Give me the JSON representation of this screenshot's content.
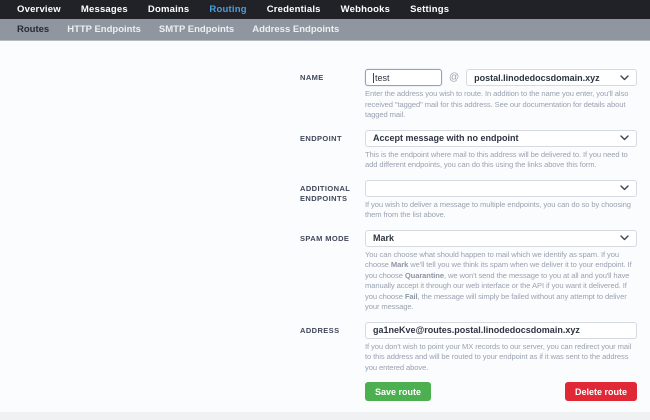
{
  "colors": {
    "accent": "#4f9ddb",
    "green": "#4caf50",
    "red": "#e02836",
    "topnav_bg": "#212227",
    "subnav_bg": "#8f969f"
  },
  "nav": {
    "items": [
      {
        "label": "Overview",
        "active": false
      },
      {
        "label": "Messages",
        "active": false
      },
      {
        "label": "Domains",
        "active": false
      },
      {
        "label": "Routing",
        "active": true
      },
      {
        "label": "Credentials",
        "active": false
      },
      {
        "label": "Webhooks",
        "active": false
      },
      {
        "label": "Settings",
        "active": false
      }
    ]
  },
  "subnav": {
    "items": [
      {
        "label": "Routes",
        "active": true
      },
      {
        "label": "HTTP Endpoints",
        "active": false
      },
      {
        "label": "SMTP Endpoints",
        "active": false
      },
      {
        "label": "Address Endpoints",
        "active": false
      }
    ]
  },
  "form": {
    "name": {
      "label": "NAME",
      "value": "test",
      "at": "@",
      "domain": "postal.linodedocsdomain.xyz",
      "help": "Enter the address you wish to route. In addition to the name you enter, you'll also received \"tagged\" mail for this address. See our documentation for details about tagged mail."
    },
    "endpoint": {
      "label": "ENDPOINT",
      "value": "Accept message with no endpoint",
      "help": "This is the endpoint where mail to this address will be delivered to. If you need to add different endpoints, you can do this using the links above this form."
    },
    "additional_endpoints": {
      "label": "ADDITIONAL ENDPOINTS",
      "value": "",
      "help": "If you wish to deliver a message to multiple endpoints, you can do so by choosing them from the list above."
    },
    "spam_mode": {
      "label": "SPAM MODE",
      "value": "Mark",
      "help_parts": [
        {
          "t": "You can choose what should happen to mail which we identify as spam. If you choose "
        },
        {
          "t": "Mark",
          "b": true
        },
        {
          "t": " we'll tell you we think its spam when we deliver it to your endpoint. If you choose "
        },
        {
          "t": "Quarantine",
          "b": true
        },
        {
          "t": ", we won't send the message to you at all and you'll have manually accept it through our web interface or the API if you want it delivered. If you choose "
        },
        {
          "t": "Fail",
          "b": true
        },
        {
          "t": ", the message will simply be failed without any attempt to deliver your message."
        }
      ]
    },
    "address": {
      "label": "ADDRESS",
      "value": "ga1neKve@routes.postal.linodedocsdomain.xyz",
      "help": "If you don't wish to point your MX records to our server, you can redirect your mail to this address and will be routed to your endpoint as if it was sent to the address you entered above."
    },
    "buttons": {
      "save": "Save route",
      "delete": "Delete route"
    }
  }
}
